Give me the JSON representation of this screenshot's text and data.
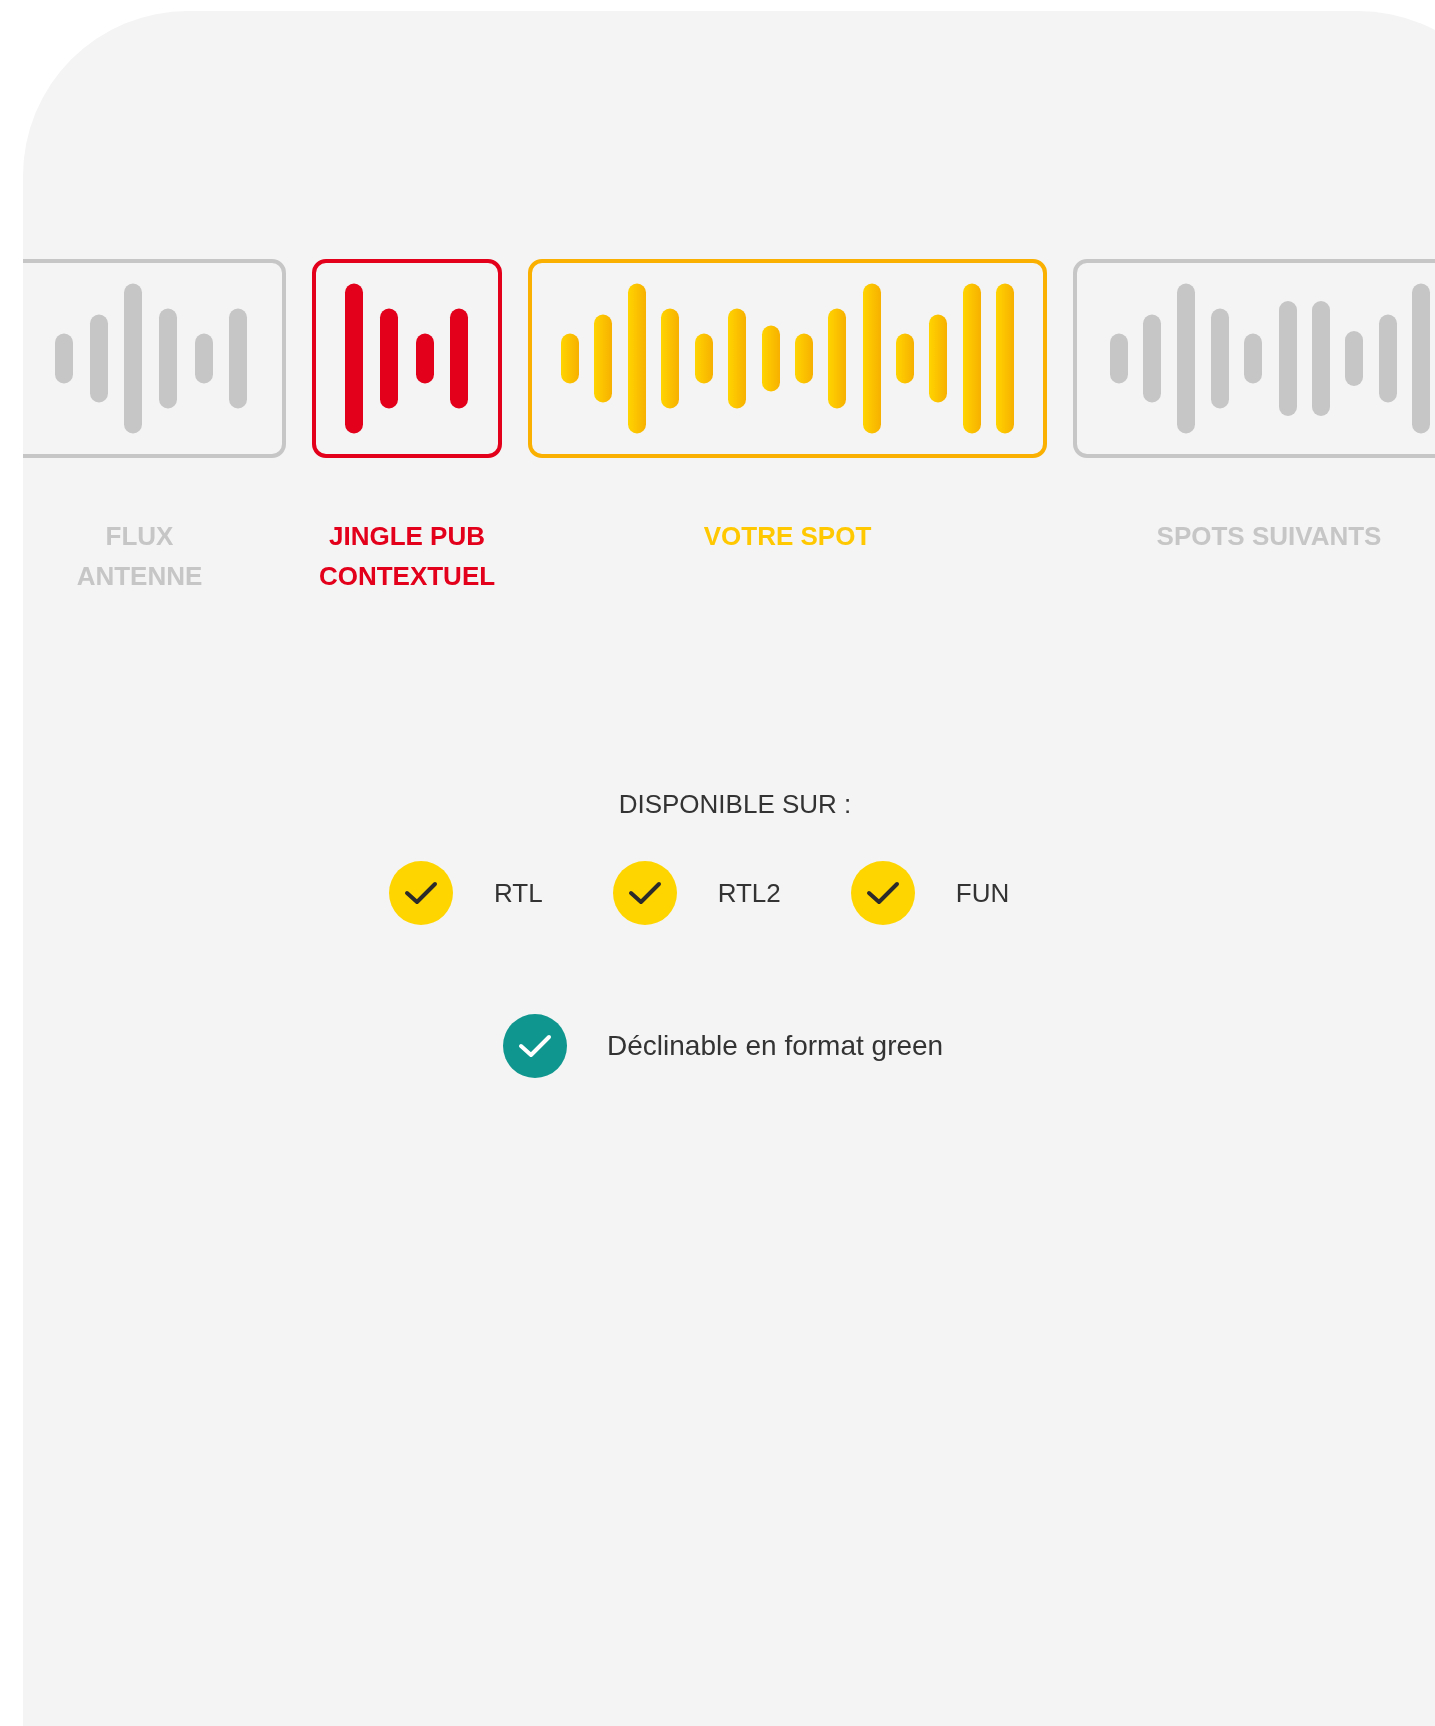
{
  "segments": [
    {
      "lines": [
        "FLUX",
        "ANTENNE"
      ],
      "color": "#c6c6c6"
    },
    {
      "lines": [
        "JINGLE PUB",
        "CONTEXTUEL"
      ],
      "color": "#e2001a"
    },
    {
      "lines": [
        "VOTRE SPOT"
      ],
      "color": "#ffc800"
    },
    {
      "lines": [
        "SPOTS SUIVANTS"
      ],
      "color": "#c6c6c6"
    }
  ],
  "availability": {
    "title": "DISPONIBLE SUR :",
    "stations": [
      {
        "label": "RTL",
        "checked": true
      },
      {
        "label": "RTL2",
        "checked": true
      },
      {
        "label": "FUN",
        "checked": true
      }
    ]
  },
  "green_option": {
    "label": "Déclinable en format green",
    "checked": true
  }
}
